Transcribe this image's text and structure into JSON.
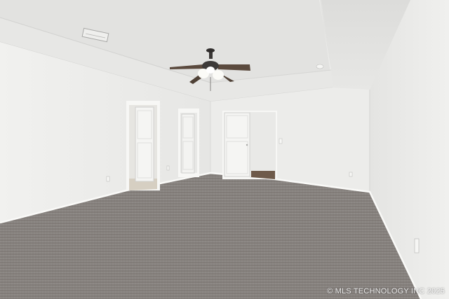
{
  "photo": {
    "subject": "empty carpeted bedroom",
    "watermark": "© MLS TECHNOLOGY INC 2025"
  },
  "palette": {
    "wall": "#eeeeec",
    "ceiling": "#e4e4e2",
    "carpet": "#8f8a86",
    "door": "#f6f6f4",
    "floor_wood": "#6e5a4a"
  }
}
